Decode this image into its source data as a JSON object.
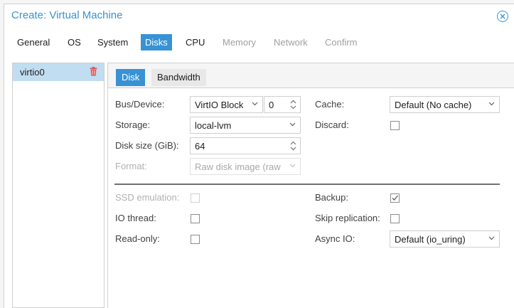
{
  "dialog": {
    "title": "Create: Virtual Machine",
    "close_icon": "close-circle-icon"
  },
  "tabs": [
    {
      "label": "General",
      "state": "enabled"
    },
    {
      "label": "OS",
      "state": "enabled"
    },
    {
      "label": "System",
      "state": "enabled"
    },
    {
      "label": "Disks",
      "state": "active"
    },
    {
      "label": "CPU",
      "state": "enabled"
    },
    {
      "label": "Memory",
      "state": "disabled"
    },
    {
      "label": "Network",
      "state": "disabled"
    },
    {
      "label": "Confirm",
      "state": "disabled"
    }
  ],
  "disk_list": {
    "items": [
      {
        "label": "virtio0",
        "selected": true,
        "action_icon": "trash-icon"
      }
    ]
  },
  "subtabs": [
    {
      "label": "Disk",
      "active": true
    },
    {
      "label": "Bandwidth",
      "active": false
    }
  ],
  "form": {
    "bus_device": {
      "label": "Bus/Device:",
      "bus_value": "VirtIO Block",
      "device_value": "0"
    },
    "storage": {
      "label": "Storage:",
      "value": "local-lvm"
    },
    "disk_size": {
      "label": "Disk size (GiB):",
      "value": "64"
    },
    "format": {
      "label": "Format:",
      "value": "Raw disk image (raw",
      "disabled": true
    },
    "cache": {
      "label": "Cache:",
      "value": "Default (No cache)"
    },
    "discard": {
      "label": "Discard:",
      "checked": false
    },
    "ssd_emulation": {
      "label": "SSD emulation:",
      "checked": false,
      "disabled": true
    },
    "io_thread": {
      "label": "IO thread:",
      "checked": false
    },
    "read_only": {
      "label": "Read-only:",
      "checked": false
    },
    "backup": {
      "label": "Backup:",
      "checked": true
    },
    "skip_replication": {
      "label": "Skip replication:",
      "checked": false
    },
    "async_io": {
      "label": "Async IO:",
      "value": "Default (io_uring)"
    }
  },
  "colors": {
    "accent": "#3892d4",
    "selected_row": "#c1ddf1",
    "delete_icon": "#e05555"
  }
}
